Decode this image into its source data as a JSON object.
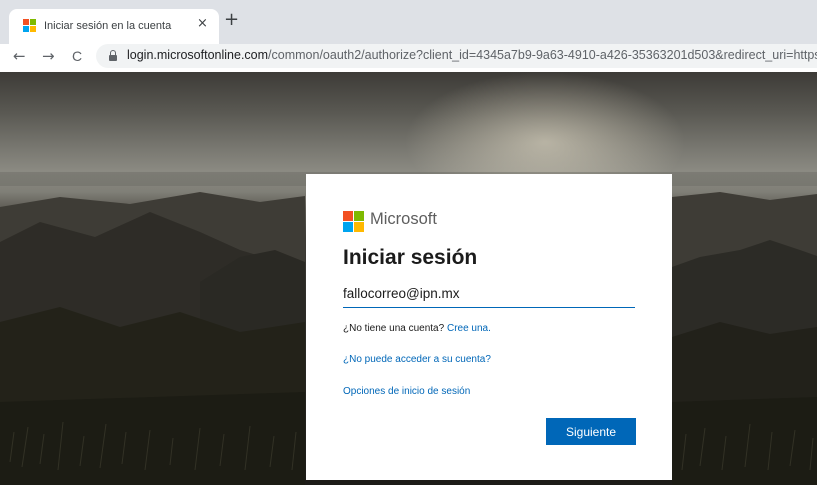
{
  "browser": {
    "tab": {
      "title": "Iniciar sesión en la cuenta",
      "close_glyph": "×",
      "favicon_colors": [
        "#f25022",
        "#7fba00",
        "#00a4ef",
        "#ffb900"
      ]
    },
    "new_tab_glyph": "+",
    "nav": {
      "back_glyph": "←",
      "forward_glyph": "→",
      "reload_glyph": "C"
    },
    "address": {
      "domain": "login.microsoftonline.com",
      "path": "/common/oauth2/authorize?client_id=4345a7b9-9a63-4910-a426-35363201d503&redirect_uri=https%3A%2"
    }
  },
  "signin": {
    "brand": "Microsoft",
    "logo_colors": [
      "#f25022",
      "#7fba00",
      "#00a4ef",
      "#ffb900"
    ],
    "title": "Iniciar sesión",
    "email_value": "fallocorreo@ipn.mx",
    "no_account_text": "¿No tiene una cuenta?",
    "create_link": "Cree una.",
    "cant_access_link": "¿No puede acceder a su cuenta?",
    "options_link": "Opciones de inicio de sesión",
    "next_button": "Siguiente"
  },
  "colors": {
    "accent": "#0067b8",
    "tabstrip": "#dee1e6"
  }
}
